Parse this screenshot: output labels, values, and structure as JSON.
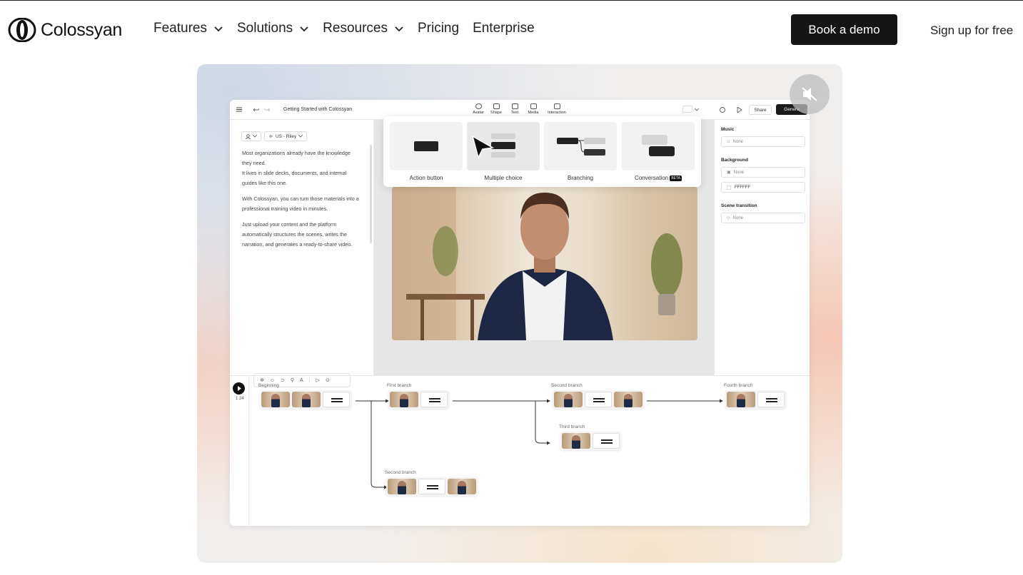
{
  "nav": {
    "logo_text": "Colossyan",
    "menu": [
      {
        "label": "Features",
        "has_dropdown": true
      },
      {
        "label": "Solutions",
        "has_dropdown": true
      },
      {
        "label": "Resources",
        "has_dropdown": true
      },
      {
        "label": "Pricing",
        "has_dropdown": false
      },
      {
        "label": "Enterprise",
        "has_dropdown": false
      }
    ],
    "cta": "Book a demo",
    "signup": "Sign up for free"
  },
  "hero": {
    "mute_icon": "speaker-muted-icon"
  },
  "editor": {
    "title": "Getting Started with Colossyan",
    "toolbar": [
      "Avatar",
      "Shape",
      "Text",
      "Media",
      "Interaction"
    ],
    "share": "Share",
    "generate": "Genera",
    "voice": "US - Riley",
    "script": [
      "Most organizations already have the knowledge they need.",
      "It lives in slide decks, documents, and internal guides like this one.",
      "With Colossyan, you can turn those materials into a professional training video in minutes.",
      "Just upload your content and the platform automatically structures the scenes, writes the narration, and generates a ready-to-share video."
    ],
    "interaction_types": [
      {
        "label": "Action button"
      },
      {
        "label": "Multiple choice"
      },
      {
        "label": "Branching"
      },
      {
        "label": "Conversation",
        "badge": "BETA"
      }
    ],
    "right_panel": {
      "music_label": "Music",
      "music_value": "None",
      "background_label": "Background",
      "background_value": "None",
      "background_color": "FFFFFF",
      "transition_label": "Scene transition",
      "transition_value": "None"
    },
    "timeline": {
      "count": "1 24",
      "branches": [
        "Beginning",
        "First branch",
        "Second branch",
        "Third branch",
        "Fourth branch",
        "Second branch"
      ]
    }
  },
  "colors": {
    "accent": "#151515",
    "background": "#ffffff"
  }
}
